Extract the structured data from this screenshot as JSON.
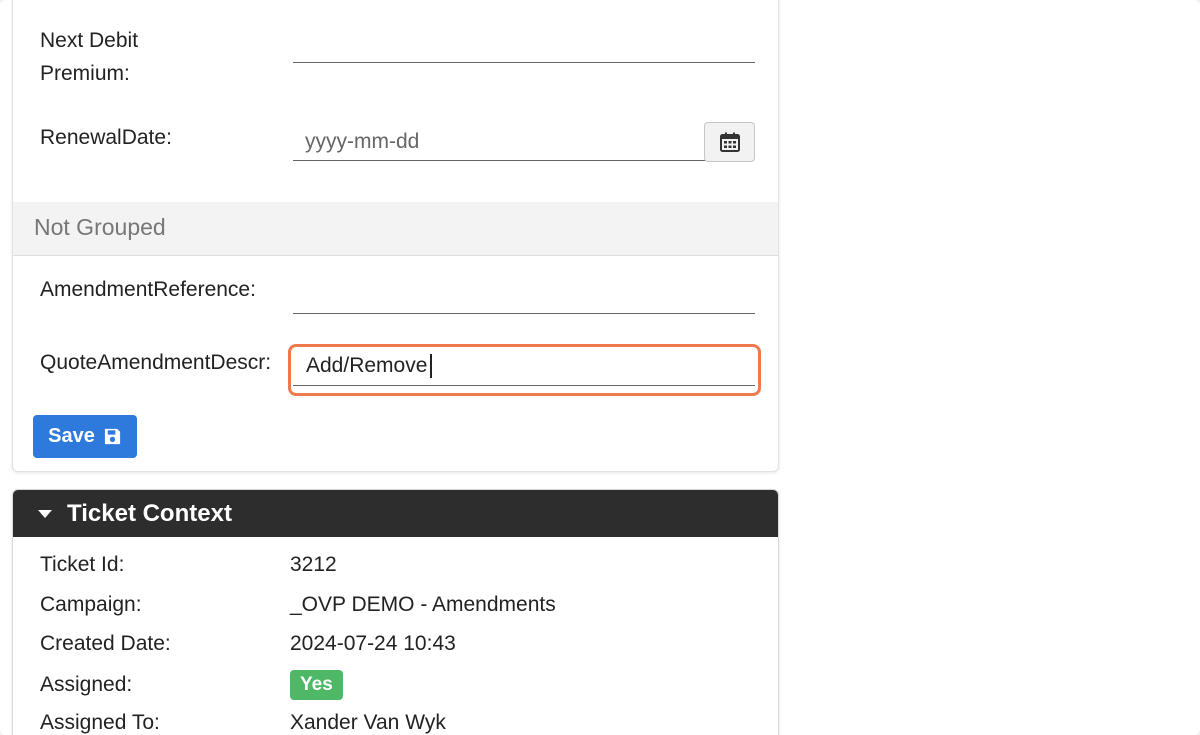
{
  "form": {
    "next_debit_label_line1": "Next Debit",
    "next_debit_label_line2": "Premium:",
    "next_debit_value": "",
    "renewal_label": "RenewalDate:",
    "renewal_placeholder": "yyyy-mm-dd",
    "section_title": "Not Grouped",
    "amendment_ref_label": "AmendmentReference:",
    "amendment_ref_value": "",
    "quote_desc_label": "QuoteAmendmentDescr:",
    "quote_desc_value": "Add/Remove",
    "save_label": "Save"
  },
  "ticket_context": {
    "title": "Ticket Context",
    "rows": [
      {
        "label": "Ticket Id:",
        "value": "3212"
      },
      {
        "label": "Campaign:",
        "value": "_OVP DEMO - Amendments"
      },
      {
        "label": "Created Date:",
        "value": "2024-07-24 10:43"
      },
      {
        "label": "Assigned:",
        "value": "Yes"
      },
      {
        "label": "Assigned To:",
        "value": "Xander Van Wyk"
      }
    ]
  },
  "colors": {
    "primary": "#2e79dc",
    "highlight": "#ef7b4c",
    "badge_success": "#4eb867",
    "header_dark": "#2d2d2d"
  },
  "icons": {
    "calendar": "calendar-icon",
    "save": "floppy-disk-icon",
    "collapse": "caret-down-icon"
  }
}
